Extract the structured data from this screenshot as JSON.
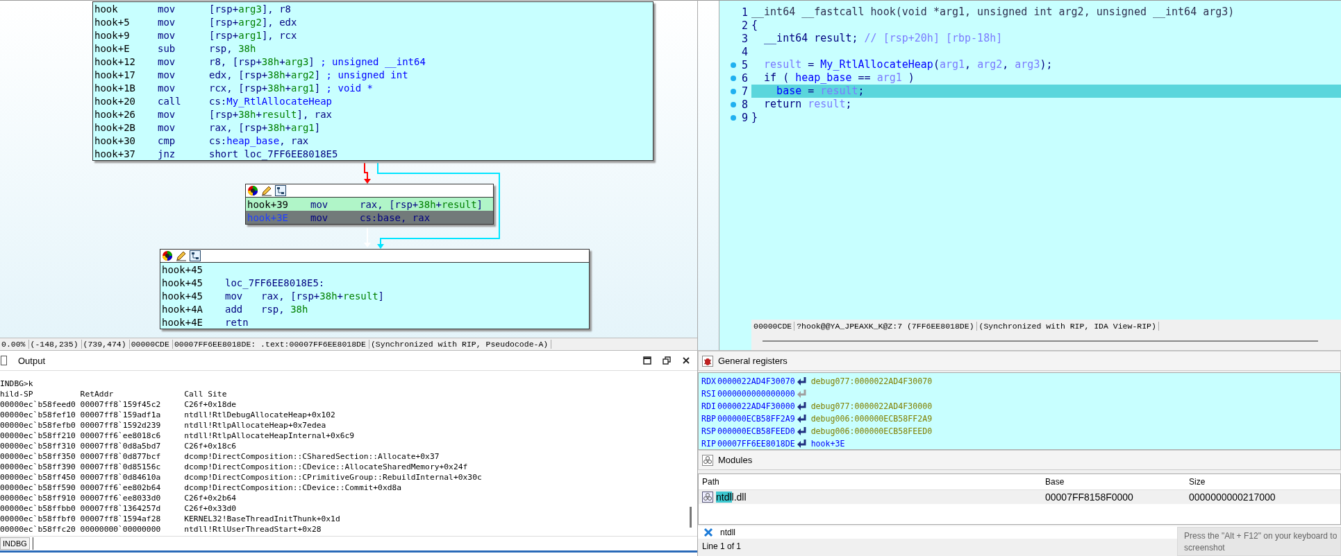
{
  "graph": {
    "blocks": [
      {
        "toolbar": false,
        "lines": [
          {
            "addr": "hook",
            "mnem": "mov",
            "ops": [
              {
                "text": "[rsp+",
                "kind": "p"
              },
              {
                "text": "arg3",
                "kind": "v"
              },
              {
                "text": "], r8",
                "kind": "p"
              }
            ]
          },
          {
            "addr": "hook+5",
            "mnem": "mov",
            "ops": [
              {
                "text": "[rsp+",
                "kind": "p"
              },
              {
                "text": "arg2",
                "kind": "v"
              },
              {
                "text": "], edx",
                "kind": "p"
              }
            ]
          },
          {
            "addr": "hook+9",
            "mnem": "mov",
            "ops": [
              {
                "text": "[rsp+",
                "kind": "p"
              },
              {
                "text": "arg1",
                "kind": "v"
              },
              {
                "text": "], rcx",
                "kind": "p"
              }
            ]
          },
          {
            "addr": "hook+E",
            "mnem": "sub",
            "ops": [
              {
                "text": "rsp, ",
                "kind": "p"
              },
              {
                "text": "38h",
                "kind": "v"
              }
            ]
          },
          {
            "addr": "hook+12",
            "mnem": "mov",
            "ops": [
              {
                "text": "r8, [rsp+",
                "kind": "p"
              },
              {
                "text": "38h",
                "kind": "v"
              },
              {
                "text": "+",
                "kind": "p"
              },
              {
                "text": "arg3",
                "kind": "v"
              },
              {
                "text": "] ",
                "kind": "p"
              },
              {
                "text": "; unsigned __int64",
                "kind": "c"
              }
            ]
          },
          {
            "addr": "hook+17",
            "mnem": "mov",
            "ops": [
              {
                "text": "edx, [rsp+",
                "kind": "p"
              },
              {
                "text": "38h",
                "kind": "v"
              },
              {
                "text": "+",
                "kind": "p"
              },
              {
                "text": "arg2",
                "kind": "v"
              },
              {
                "text": "] ",
                "kind": "p"
              },
              {
                "text": "; unsigned int",
                "kind": "c"
              }
            ]
          },
          {
            "addr": "hook+1B",
            "mnem": "mov",
            "ops": [
              {
                "text": "rcx, [rsp+",
                "kind": "p"
              },
              {
                "text": "38h",
                "kind": "v"
              },
              {
                "text": "+",
                "kind": "p"
              },
              {
                "text": "arg1",
                "kind": "v"
              },
              {
                "text": "] ",
                "kind": "p"
              },
              {
                "text": "; void *",
                "kind": "c"
              }
            ]
          },
          {
            "addr": "hook+20",
            "mnem": "call",
            "ops": [
              {
                "text": "cs:",
                "kind": "p"
              },
              {
                "text": "My_RtlAllocateHeap",
                "kind": "n"
              }
            ]
          },
          {
            "addr": "hook+26",
            "mnem": "mov",
            "ops": [
              {
                "text": "[rsp+",
                "kind": "p"
              },
              {
                "text": "38h",
                "kind": "v"
              },
              {
                "text": "+",
                "kind": "p"
              },
              {
                "text": "result",
                "kind": "v"
              },
              {
                "text": "], rax",
                "kind": "p"
              }
            ]
          },
          {
            "addr": "hook+2B",
            "mnem": "mov",
            "ops": [
              {
                "text": "rax, [rsp+",
                "kind": "p"
              },
              {
                "text": "38h",
                "kind": "v"
              },
              {
                "text": "+",
                "kind": "p"
              },
              {
                "text": "arg1",
                "kind": "v"
              },
              {
                "text": "]",
                "kind": "p"
              }
            ]
          },
          {
            "addr": "hook+30",
            "mnem": "cmp",
            "ops": [
              {
                "text": "cs:",
                "kind": "p"
              },
              {
                "text": "heap_base",
                "kind": "n"
              },
              {
                "text": ", rax",
                "kind": "p"
              }
            ]
          },
          {
            "addr": "hook+37",
            "mnem": "jnz",
            "ops": [
              {
                "text": "short loc_7FF6EE8018E5",
                "kind": "p"
              }
            ]
          }
        ]
      },
      {
        "toolbar": true,
        "lines": [
          {
            "addr": "hook+39",
            "mnem": "mov",
            "executed": true,
            "current": false,
            "ops": [
              {
                "text": "rax, [rsp+",
                "kind": "p"
              },
              {
                "text": "38h",
                "kind": "v"
              },
              {
                "text": "+",
                "kind": "p"
              },
              {
                "text": "result",
                "kind": "v"
              },
              {
                "text": "]",
                "kind": "p"
              }
            ]
          },
          {
            "addr": "hook+3E",
            "mnem": "mov",
            "executed": false,
            "current": true,
            "ops": [
              {
                "text": "cs:base, rax",
                "kind": "p"
              }
            ]
          }
        ]
      },
      {
        "toolbar": true,
        "lines": [
          {
            "addr": "hook+45"
          },
          {
            "addr": "hook+45",
            "label": "loc_7FF6EE8018E5:"
          },
          {
            "addr": "hook+45",
            "mnem": "mov",
            "ops": [
              {
                "text": "rax, [rsp+",
                "kind": "p"
              },
              {
                "text": "38h",
                "kind": "v"
              },
              {
                "text": "+",
                "kind": "p"
              },
              {
                "text": "result",
                "kind": "v"
              },
              {
                "text": "]",
                "kind": "p"
              }
            ]
          },
          {
            "addr": "hook+4A",
            "mnem": "add",
            "ops": [
              {
                "text": "rsp, ",
                "kind": "p"
              },
              {
                "text": "38h",
                "kind": "v"
              }
            ]
          },
          {
            "addr": "hook+4E",
            "mnem": "retn"
          }
        ]
      }
    ],
    "edges": [
      {
        "kind": "taken",
        "color": "#ff0000"
      },
      {
        "kind": "jump",
        "color": "#00e5ff"
      },
      {
        "kind": "fallthrough",
        "color": "#ffffff"
      }
    ],
    "status": [
      "0.00%",
      "(-148,235)",
      "(739,474)",
      "00000CDE",
      "00007FF6EE8018DE: .text:00007FF6EE8018DE",
      "(Synchronized with RIP, Pseudocode-A)"
    ]
  },
  "pseudocode": {
    "lines": [
      {
        "num": "1",
        "breakpoint": false,
        "selected": false,
        "tokens": [
          {
            "text": "__int64 __fastcall hook(void *arg1, unsigned int arg2, unsigned __int64 arg3)",
            "kind": "h"
          }
        ]
      },
      {
        "num": "2",
        "breakpoint": false,
        "selected": false,
        "tokens": [
          {
            "text": "{",
            "kind": "k"
          }
        ]
      },
      {
        "num": "3",
        "breakpoint": false,
        "selected": false,
        "tokens": [
          {
            "text": "  __int64 result; ",
            "kind": "k"
          },
          {
            "text": "// [rsp+20h] [rbp-18h]",
            "kind": "c"
          }
        ]
      },
      {
        "num": "4",
        "breakpoint": false,
        "selected": false
      },
      {
        "num": "5",
        "breakpoint": true,
        "selected": false,
        "tokens": [
          {
            "text": "  result",
            "kind": "v"
          },
          {
            "text": " = ",
            "kind": "k"
          },
          {
            "text": "My_RtlAllocateHeap",
            "kind": "g"
          },
          {
            "text": "(",
            "kind": "k"
          },
          {
            "text": "arg1",
            "kind": "v"
          },
          {
            "text": ", ",
            "kind": "k"
          },
          {
            "text": "arg2",
            "kind": "v"
          },
          {
            "text": ", ",
            "kind": "k"
          },
          {
            "text": "arg3",
            "kind": "v"
          },
          {
            "text": ");",
            "kind": "k"
          }
        ]
      },
      {
        "num": "6",
        "breakpoint": true,
        "selected": false,
        "tokens": [
          {
            "text": "  if ( ",
            "kind": "k"
          },
          {
            "text": "heap_base",
            "kind": "g"
          },
          {
            "text": " == ",
            "kind": "k"
          },
          {
            "text": "arg1",
            "kind": "v"
          },
          {
            "text": " )",
            "kind": "k"
          }
        ]
      },
      {
        "num": "7",
        "breakpoint": true,
        "selected": true,
        "tokens": [
          {
            "text": "    base",
            "kind": "g"
          },
          {
            "text": " = ",
            "kind": "k"
          },
          {
            "text": "result",
            "kind": "v"
          },
          {
            "text": ";",
            "kind": "k"
          }
        ]
      },
      {
        "num": "8",
        "breakpoint": true,
        "selected": false,
        "tokens": [
          {
            "text": "  return ",
            "kind": "k"
          },
          {
            "text": "result",
            "kind": "v"
          },
          {
            "text": ";",
            "kind": "k"
          }
        ]
      },
      {
        "num": "9",
        "breakpoint": true,
        "selected": false,
        "tokens": [
          {
            "text": "}",
            "kind": "k"
          }
        ]
      }
    ],
    "status": [
      "00000CDE",
      "?hook@@YA_JPEAXK_K@Z:7 (7FF6EE8018DE)",
      "(Synchronized with RIP, IDA View-RIP)"
    ]
  },
  "output": {
    "title": "Output",
    "lines": [
      "INDBG>k",
      "hild-SP          RetAddr               Call Site",
      "00000ec`b58feed0 00007ff8`159f45c2     C26f+0x18de",
      "00000ec`b58fef10 00007ff8`159adf1a     ntdll!RtlDebugAllocateHeap+0x102",
      "00000ec`b58fefb0 00007ff8`1592d239     ntdll!RtlpAllocateHeap+0x7edea",
      "00000ec`b58ff210 00007ff6`ee8018c6     ntdll!RtlpAllocateHeapInternal+0x6c9",
      "00000ec`b58ff310 00007ff8`0d8a5bd7     C26f+0x18c6",
      "00000ec`b58ff350 00007ff8`0d877bcf     dcomp!DirectComposition::CSharedSection::Allocate+0x37",
      "00000ec`b58ff390 00007ff8`0d85156c     dcomp!DirectComposition::CDevice::AllocateSharedMemory+0x24f",
      "00000ec`b58ff450 00007ff8`0d84610a     dcomp!DirectComposition::CPrimitiveGroup::RebuildInternal+0x30c",
      "00000ec`b58ff590 00007ff6`ee802b64     dcomp!DirectComposition::CDevice::Commit+0xd8a",
      "00000ec`b58ff910 00007ff6`ee8033d0     C26f+0x2b64",
      "00000ec`b58ffbb0 00007ff8`1364257d     C26f+0x33d0",
      "00000ec`b58ffbf0 00007ff8`1594af28     KERNEL32!BaseThreadInitThunk+0x1d",
      "00000ec`b58ffc20 00000000`00000000     ntdll!RtlUserThreadStart+0x28"
    ],
    "command_label": "INDBG"
  },
  "registers": {
    "title": "General registers",
    "rows": [
      {
        "name": "RDX",
        "value": "0000022AD4F30070",
        "kind": "data",
        "target": "debug077:0000022AD4F30070"
      },
      {
        "name": "RSI",
        "value": "0000000000000000",
        "kind": "none"
      },
      {
        "name": "RDI",
        "value": "0000022AD4F30000",
        "kind": "data",
        "target": "debug077:0000022AD4F30000"
      },
      {
        "name": "RBP",
        "value": "000000ECB58FF2A9",
        "kind": "data",
        "target": "debug006:000000ECB58FF2A9"
      },
      {
        "name": "RSP",
        "value": "000000ECB58FEED0",
        "kind": "data",
        "target": "debug006:000000ECB58FEED0"
      },
      {
        "name": "RIP",
        "value": "00007FF6EE8018DE",
        "kind": "code",
        "target": "hook+3E"
      }
    ]
  },
  "modules": {
    "title": "Modules",
    "columns": [
      "Path",
      "Base",
      "Size"
    ],
    "rows": [
      {
        "path": [
          {
            "text": "ntdl",
            "match": true
          },
          {
            "text": "l.dll",
            "match": false
          }
        ],
        "base": "00007FF8158F0000",
        "size": "0000000000217000"
      }
    ],
    "filter": "ntdll",
    "status": "Line 1 of 1"
  },
  "notification": {
    "lines": [
      "Press the \"Alt + F12\" on your keyboard to",
      "screenshot"
    ]
  }
}
